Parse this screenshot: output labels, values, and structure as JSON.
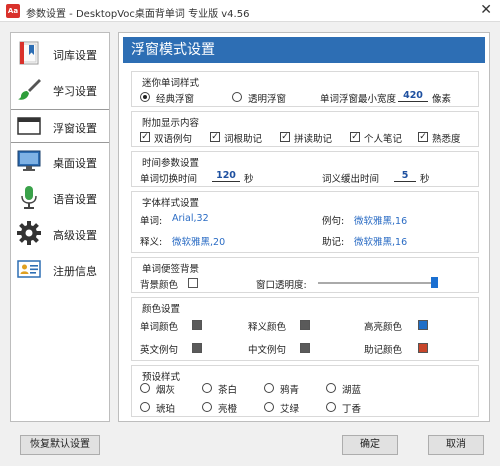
{
  "window": {
    "title": "参数设置 - DesktopVoc桌面背单词 专业版 v4.56",
    "app_icon": "Aa",
    "close_glyph": "✕"
  },
  "sidebar": {
    "items": [
      {
        "label": "词库设置",
        "icon": "book-icon"
      },
      {
        "label": "学习设置",
        "icon": "brush-icon"
      },
      {
        "label": "浮窗设置",
        "icon": "window-icon"
      },
      {
        "label": "桌面设置",
        "icon": "monitor-icon"
      },
      {
        "label": "语音设置",
        "icon": "microphone-icon"
      },
      {
        "label": "高级设置",
        "icon": "gear-icon"
      },
      {
        "label": "注册信息",
        "icon": "id-card-icon"
      }
    ],
    "active_index": 2
  },
  "main": {
    "header": "浮窗模式设置",
    "mini_style": {
      "title": "迷你单词样式",
      "opt_classic": "经典浮窗",
      "opt_transparent": "透明浮窗",
      "min_width_label": "单词浮窗最小宽度",
      "min_width_value": "420",
      "min_width_unit": "像素",
      "selected": "classic"
    },
    "extra": {
      "title": "附加显示内容",
      "items": [
        {
          "label": "双语例句",
          "checked": true
        },
        {
          "label": "词根助记",
          "checked": true
        },
        {
          "label": "拼读助记",
          "checked": true
        },
        {
          "label": "个人笔记",
          "checked": true
        },
        {
          "label": "熟悉度",
          "checked": true
        }
      ],
      "check_glyph": "✓"
    },
    "timing": {
      "title": "时间参数设置",
      "switch_label": "单词切换时间",
      "switch_value": "120",
      "switch_unit": "秒",
      "delay_label": "词义缓出时间",
      "delay_value": "5",
      "delay_unit": "秒"
    },
    "fonts": {
      "title": "字体样式设置",
      "word_label": "单词:",
      "word_value": "Arial,32",
      "example_label": "例句:",
      "example_value": "微软雅黑,16",
      "meaning_label": "释义:",
      "meaning_value": "微软雅黑,20",
      "mnemonic_label": "助记:",
      "mnemonic_value": "微软雅黑,16"
    },
    "background": {
      "title": "单词便签背景",
      "bg_color_label": "背景颜色",
      "bg_color": "#ffffff",
      "opacity_label": "窗口透明度:",
      "opacity": 1.0
    },
    "colors": {
      "title": "颜色设置",
      "word_color_label": "单词颜色",
      "word_color": "#5a5a5a",
      "meaning_color_label": "释义颜色",
      "meaning_color": "#5a5a5a",
      "highlight_color_label": "高亮颜色",
      "highlight_color": "#1f6fc8",
      "en_example_label": "英文例句",
      "en_example_color": "#5a5a5a",
      "cn_example_label": "中文例句",
      "cn_example_color": "#5a5a5a",
      "mnemonic_color_label": "助记颜色",
      "mnemonic_color": "#c8462a"
    },
    "presets": {
      "title": "预设样式",
      "items": [
        "烟灰",
        "茶白",
        "鸦青",
        "湖蓝",
        "琥珀",
        "亮橙",
        "艾绿",
        "丁香"
      ]
    }
  },
  "footer": {
    "reset_label": "恢复默认设置",
    "ok_label": "确定",
    "cancel_label": "取消"
  }
}
